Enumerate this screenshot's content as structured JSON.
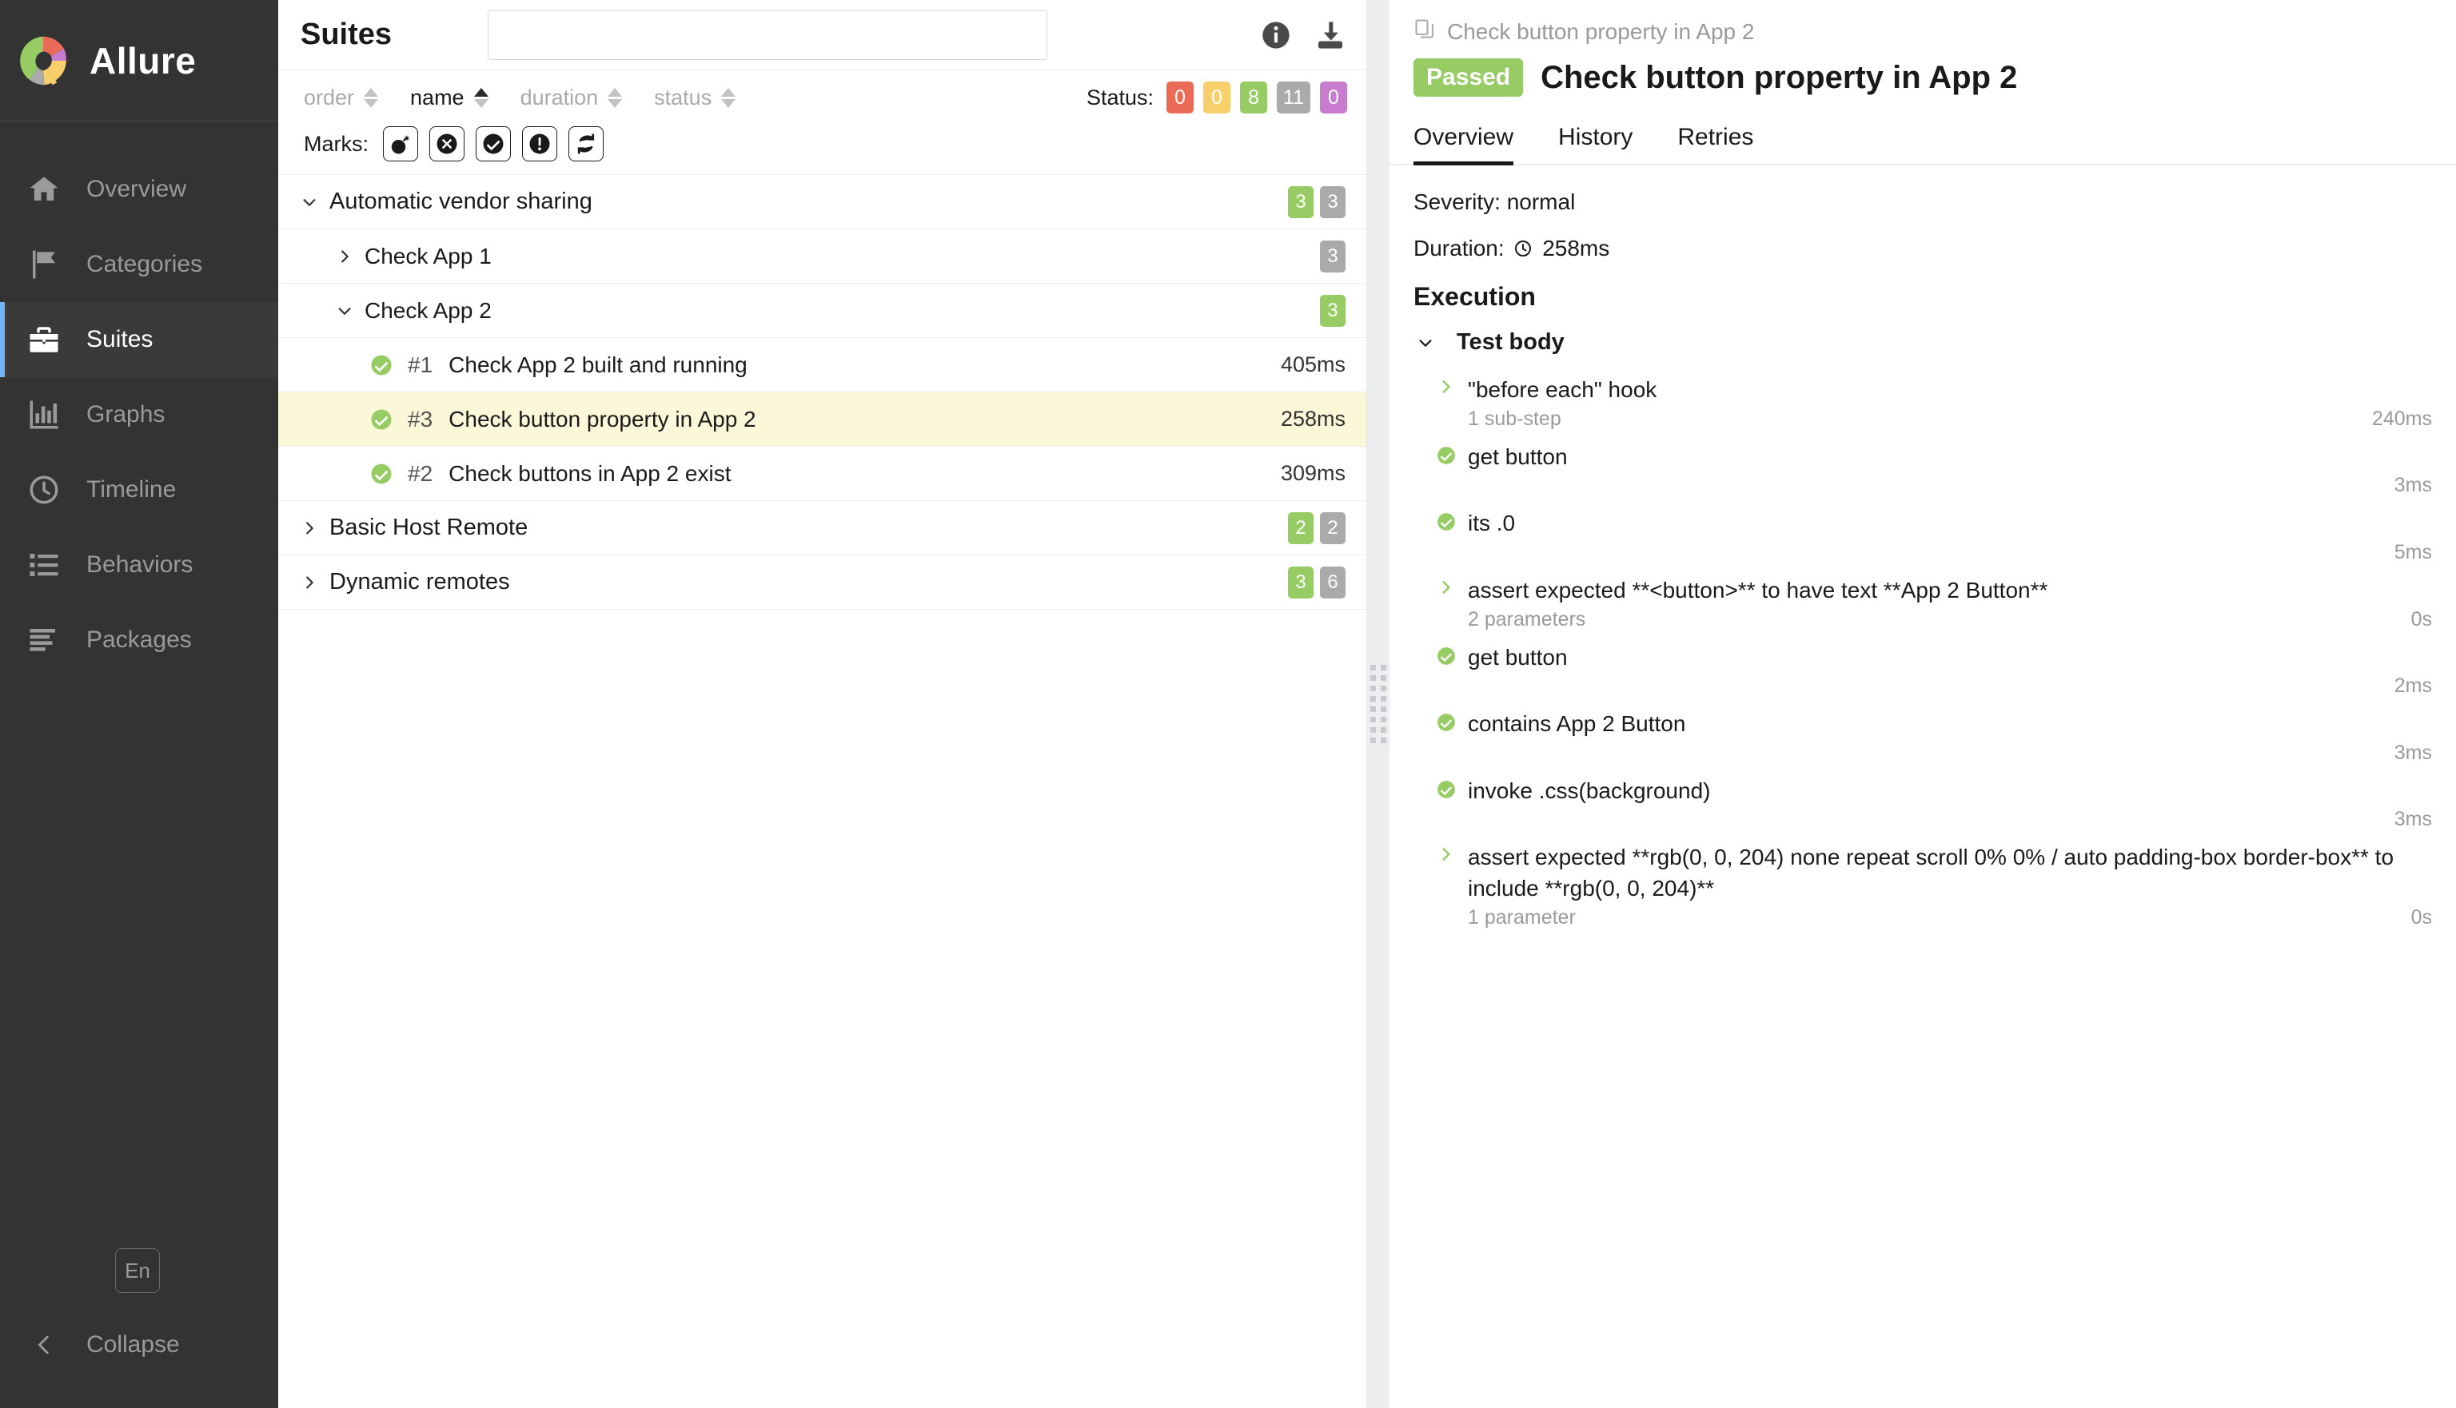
{
  "sidebar": {
    "brand": "Allure",
    "logo_colors": [
      "#97cc64",
      "#eb6b56",
      "#c77ccd",
      "#f7d06c",
      "#aaaaaa"
    ],
    "items": [
      {
        "label": "Overview",
        "icon": "home-icon",
        "active": false
      },
      {
        "label": "Categories",
        "icon": "flag-icon",
        "active": false
      },
      {
        "label": "Suites",
        "icon": "suitcase-icon",
        "active": true
      },
      {
        "label": "Graphs",
        "icon": "bar-chart-icon",
        "active": false
      },
      {
        "label": "Timeline",
        "icon": "clock-icon",
        "active": false
      },
      {
        "label": "Behaviors",
        "icon": "list-icon",
        "active": false
      },
      {
        "label": "Packages",
        "icon": "layers-icon",
        "active": false
      }
    ],
    "language_button": "En",
    "collapse_label": "Collapse",
    "collapse_icon": "chevron-left-icon"
  },
  "center": {
    "title": "Suites",
    "search": {
      "value": "",
      "placeholder": ""
    },
    "header_icons": [
      {
        "name": "info-icon"
      },
      {
        "name": "download-icon"
      }
    ],
    "sorters": [
      {
        "label": "order",
        "active": false,
        "direction": "none"
      },
      {
        "label": "name",
        "active": true,
        "direction": "asc"
      },
      {
        "label": "duration",
        "active": false,
        "direction": "none"
      },
      {
        "label": "status",
        "active": false,
        "direction": "none"
      }
    ],
    "status_label": "Status:",
    "status_badges": [
      {
        "value": "0",
        "color": "#eb6b56"
      },
      {
        "value": "0",
        "color": "#f7d06c"
      },
      {
        "value": "8",
        "color": "#97cc64"
      },
      {
        "value": "11",
        "color": "#aaaaaa"
      },
      {
        "value": "0",
        "color": "#c77ccd"
      }
    ],
    "marks_label": "Marks:",
    "marks": [
      {
        "name": "bomb-icon"
      },
      {
        "name": "times-circle-icon"
      },
      {
        "name": "check-circle-icon"
      },
      {
        "name": "exclamation-circle-icon"
      },
      {
        "name": "retry-icon"
      }
    ],
    "rows": [
      {
        "kind": "suite",
        "level": 0,
        "label": "Automatic vendor sharing",
        "expanded": true,
        "selected": false,
        "badges": [
          {
            "value": "3",
            "color": "#97cc64"
          },
          {
            "value": "3",
            "color": "#aaaaaa"
          }
        ]
      },
      {
        "kind": "suite",
        "level": 1,
        "label": "Check App 1",
        "expanded": false,
        "selected": false,
        "badges": [
          {
            "value": "3",
            "color": "#aaaaaa"
          }
        ]
      },
      {
        "kind": "suite",
        "level": 1,
        "label": "Check App 2",
        "expanded": true,
        "selected": false,
        "badges": [
          {
            "value": "3",
            "color": "#97cc64"
          }
        ]
      },
      {
        "kind": "test",
        "level": 2,
        "num": "#1",
        "label": "Check App 2 built and running",
        "status": "passed",
        "duration": "405ms",
        "selected": false
      },
      {
        "kind": "test",
        "level": 2,
        "num": "#3",
        "label": "Check button property in App 2",
        "status": "passed",
        "duration": "258ms",
        "selected": true
      },
      {
        "kind": "test",
        "level": 2,
        "num": "#2",
        "label": "Check buttons in App 2 exist",
        "status": "passed",
        "duration": "309ms",
        "selected": false
      },
      {
        "kind": "suite",
        "level": 0,
        "label": "Basic Host Remote",
        "expanded": false,
        "selected": false,
        "badges": [
          {
            "value": "2",
            "color": "#97cc64"
          },
          {
            "value": "2",
            "color": "#aaaaaa"
          }
        ]
      },
      {
        "kind": "suite",
        "level": 0,
        "label": "Dynamic remotes",
        "expanded": false,
        "selected": false,
        "badges": [
          {
            "value": "3",
            "color": "#97cc64"
          },
          {
            "value": "6",
            "color": "#aaaaaa"
          }
        ]
      }
    ]
  },
  "detail": {
    "breadcrumb": "Check button property in App 2",
    "breadcrumb_icon": "copy-icon",
    "status_pill": "Passed",
    "status_color": "#97cc64",
    "title": "Check button property in App 2",
    "tabs": [
      {
        "label": "Overview",
        "active": true
      },
      {
        "label": "History",
        "active": false
      },
      {
        "label": "Retries",
        "active": false
      }
    ],
    "severity": "Severity: normal",
    "duration_label": "Duration:",
    "duration_value": "258ms",
    "duration_icon": "clock-icon",
    "execution_heading": "Execution",
    "test_body_label": "Test body",
    "test_body_expanded": true,
    "steps": [
      {
        "name": "\"before each\" hook",
        "icon": "chevron-right-icon",
        "expandable": true,
        "sub": "1 sub-step",
        "time": "240ms"
      },
      {
        "name": "get button",
        "icon": "check-circle-icon",
        "expandable": false,
        "sub": "",
        "time": "3ms"
      },
      {
        "name": "its .0",
        "icon": "check-circle-icon",
        "expandable": false,
        "sub": "",
        "time": "5ms"
      },
      {
        "name": "assert expected **<button>** to have text **App 2 Button**",
        "icon": "chevron-right-icon",
        "expandable": true,
        "sub": "2 parameters",
        "time": "0s"
      },
      {
        "name": "get button",
        "icon": "check-circle-icon",
        "expandable": false,
        "sub": "",
        "time": "2ms"
      },
      {
        "name": "contains App 2 Button",
        "icon": "check-circle-icon",
        "expandable": false,
        "sub": "",
        "time": "3ms"
      },
      {
        "name": "invoke .css(background)",
        "icon": "check-circle-icon",
        "expandable": false,
        "sub": "",
        "time": "3ms"
      },
      {
        "name": "assert expected **rgb(0, 0, 204) none repeat scroll 0% 0% / auto padding-box border-box** to include **rgb(0, 0, 204)**",
        "icon": "chevron-right-icon",
        "expandable": true,
        "sub": "1 parameter",
        "time": "0s"
      }
    ]
  }
}
